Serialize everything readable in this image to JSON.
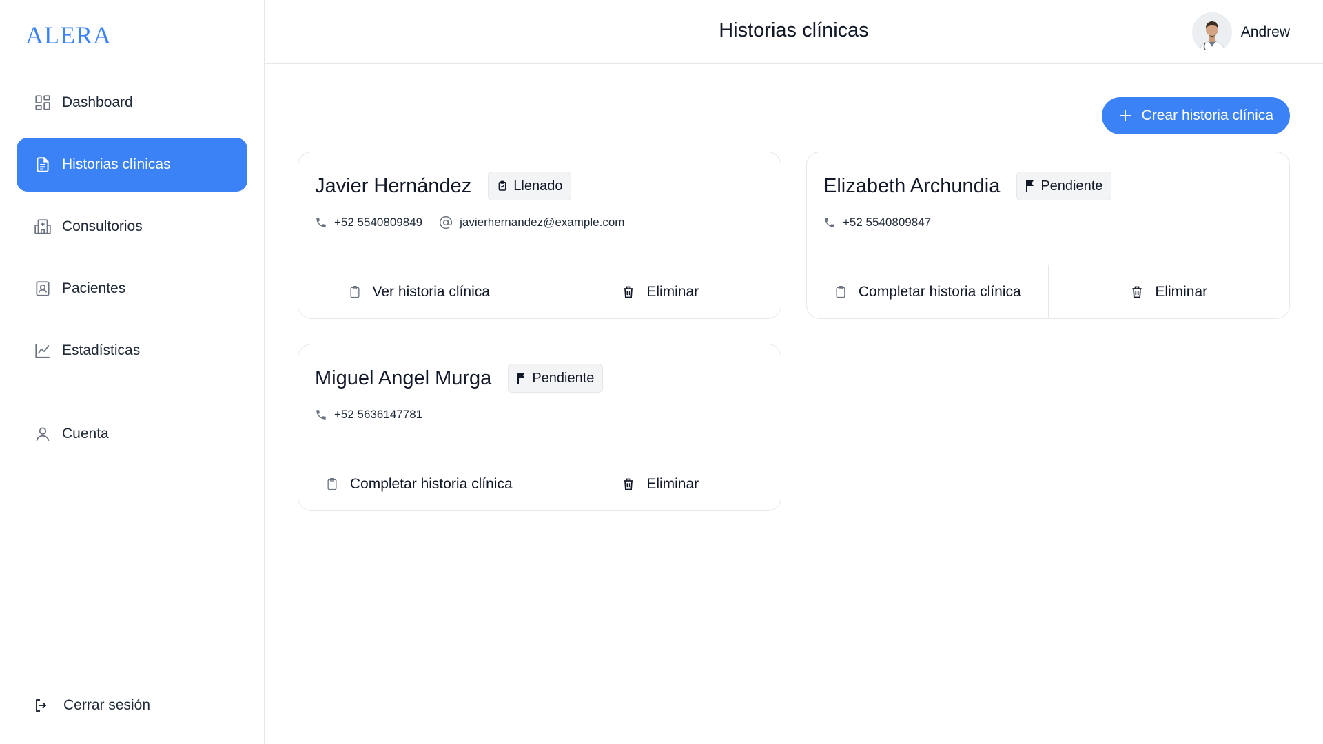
{
  "brand": {
    "logo_text": "ALERA",
    "accent": "#3b82f6"
  },
  "sidebar": {
    "items": [
      {
        "label": "Dashboard",
        "icon": "dashboard-grid-icon",
        "active": false
      },
      {
        "label": "Historias clínicas",
        "icon": "document-icon",
        "active": true
      },
      {
        "label": "Consultorios",
        "icon": "hospital-icon",
        "active": false
      },
      {
        "label": "Pacientes",
        "icon": "patient-badge-icon",
        "active": false
      },
      {
        "label": "Estadísticas",
        "icon": "chart-line-icon",
        "active": false
      }
    ],
    "account": {
      "label": "Cuenta",
      "icon": "user-icon"
    },
    "logout": {
      "label": "Cerrar sesión",
      "icon": "logout-icon"
    }
  },
  "header": {
    "title": "Historias clínicas",
    "user": {
      "name": "Andrew",
      "avatar": "doctor-avatar"
    }
  },
  "main": {
    "create_button": {
      "label": "Crear historia clínica",
      "icon": "plus-icon"
    },
    "cards": [
      {
        "name": "Javier Hernández",
        "status": {
          "label": "Llenado",
          "icon": "clipboard-check-icon"
        },
        "phone": "+52 5540809849",
        "email": "javierhernandez@example.com",
        "primary_action": "Ver historia clínica",
        "delete_action": "Eliminar"
      },
      {
        "name": "Elizabeth Archundia",
        "status": {
          "label": "Pendiente",
          "icon": "flag-icon"
        },
        "phone": "+52 5540809847",
        "primary_action": "Completar historia clínica",
        "delete_action": "Eliminar"
      },
      {
        "name": "Miguel Angel Murga",
        "status": {
          "label": "Pendiente",
          "icon": "flag-icon"
        },
        "phone": "+52 5636147781",
        "primary_action": "Completar historia clínica",
        "delete_action": "Eliminar"
      }
    ]
  }
}
